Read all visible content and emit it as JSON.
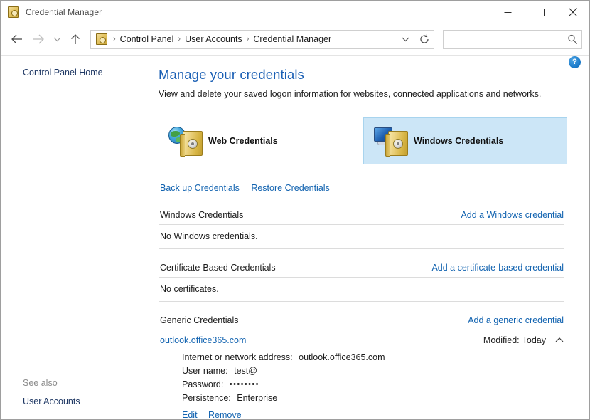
{
  "window": {
    "title": "Credential Manager",
    "icon": "credential-vault-icon",
    "controls": {
      "minimize": "minimize-icon",
      "maximize": "maximize-icon",
      "close": "close-icon"
    }
  },
  "navbar": {
    "back": "back-arrow-icon",
    "forward": "forward-arrow-icon",
    "recent": "chevron-down-icon",
    "up": "up-arrow-icon",
    "address_icon": "credential-vault-icon",
    "breadcrumbs": [
      "Control Panel",
      "User Accounts",
      "Credential Manager"
    ],
    "breadcrumb_separator": "›",
    "dropdown": "chevron-down-icon",
    "refresh": "refresh-icon",
    "search": {
      "value": "",
      "placeholder": "",
      "icon": "search-icon"
    }
  },
  "sidebar": {
    "home_link": "Control Panel Home",
    "see_also_label": "See also",
    "see_also_items": [
      "User Accounts"
    ]
  },
  "content": {
    "help_button": "?",
    "title": "Manage your credentials",
    "subtitle": "View and delete your saved logon information for websites, connected applications and networks.",
    "tiles": [
      {
        "label": "Web Credentials",
        "icon": "globe-vault-icon",
        "selected": false
      },
      {
        "label": "Windows Credentials",
        "icon": "monitor-vault-icon",
        "selected": true
      }
    ],
    "actions": [
      {
        "label": "Back up Credentials"
      },
      {
        "label": "Restore Credentials"
      }
    ],
    "sections": [
      {
        "title": "Windows Credentials",
        "add_link": "Add a Windows credential",
        "empty_text": "No Windows credentials."
      },
      {
        "title": "Certificate-Based Credentials",
        "add_link": "Add a certificate-based credential",
        "empty_text": "No certificates."
      },
      {
        "title": "Generic Credentials",
        "add_link": "Add a generic credential",
        "empty_text": ""
      }
    ],
    "credential": {
      "name": "outlook.office365.com",
      "modified_label": "Modified:",
      "modified_value": "Today",
      "expand_icon": "chevron-up-icon",
      "details": [
        {
          "label": "Internet or network address:",
          "value": "outlook.office365.com"
        },
        {
          "label": "User name:",
          "value": "test@"
        },
        {
          "label": "Password:",
          "value": "••••••••"
        },
        {
          "label": "Persistence:",
          "value": "Enterprise"
        }
      ],
      "actions": [
        {
          "label": "Edit"
        },
        {
          "label": "Remove"
        }
      ]
    }
  },
  "colors": {
    "link": "#1263b0",
    "title": "#1a5fb4",
    "selected_tile_bg": "#cce6f7",
    "sidebar_link": "#1f3864"
  }
}
